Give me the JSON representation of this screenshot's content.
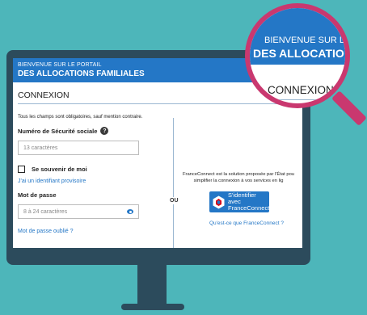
{
  "banner": {
    "line1": "BIENVENUE SUR LE PORTAIL",
    "line2": "DES ALLOCATIONS FAMILIALES"
  },
  "login": {
    "title": "CONNEXION",
    "mandatory_note": "Tous les champs sont obligatoires, sauf mention contraire.",
    "ssn_label": "Numéro de Sécurité sociale",
    "ssn_placeholder": "13 caractères",
    "remember_label": "Se souvenir de moi",
    "temp_id_link": "J'ai un identifiant provisoire",
    "password_label": "Mot de passe",
    "password_placeholder": "8 à 24 caractères",
    "forgot_link": "Mot de passe oublié ?"
  },
  "separator": "OU",
  "franceconnect": {
    "description_line1": "FranceConnect est la solution proposée par l'État pou",
    "description_line2": "simplifier la connexion à vos services en lig",
    "button_line1": "S'identifier avec",
    "button_line2": "FranceConnect",
    "info_link": "Qu'est-ce que FranceConnect ?"
  },
  "magnifier": {
    "line1": "BIENVENUE SUR L",
    "line2": "DES ALLOCATIO",
    "title": "CONNEXION"
  },
  "colors": {
    "background": "#4db6ba",
    "monitor": "#2c4b5c",
    "brand_blue": "#2477c6",
    "magnifier": "#c9386f"
  },
  "icons": [
    "help-icon",
    "eye-icon",
    "franceconnect-logo-icon",
    "checkbox-icon"
  ]
}
